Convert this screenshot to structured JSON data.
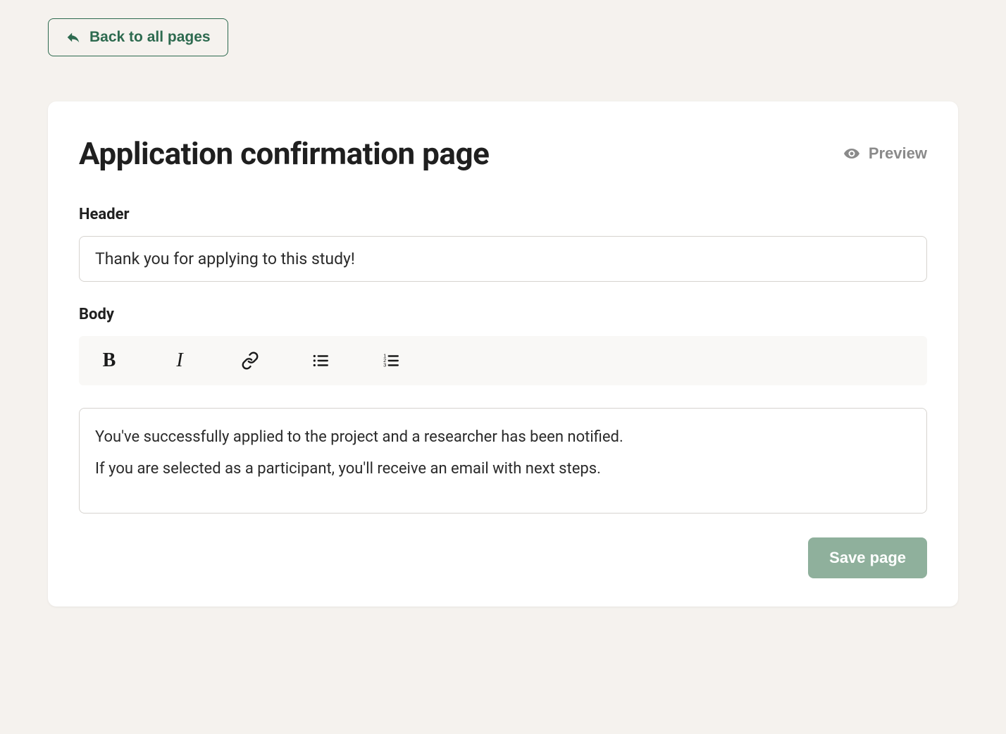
{
  "nav": {
    "back_label": "Back to all pages"
  },
  "page": {
    "title": "Application confirmation page",
    "preview_label": "Preview"
  },
  "form": {
    "header_label": "Header",
    "header_value": "Thank you for applying to this study!",
    "body_label": "Body",
    "body_paragraph_1": "You've successfully applied to the project and a researcher has been notified.",
    "body_paragraph_2": "If you are selected as a participant, you'll receive an email with next steps.",
    "save_label": "Save page"
  }
}
